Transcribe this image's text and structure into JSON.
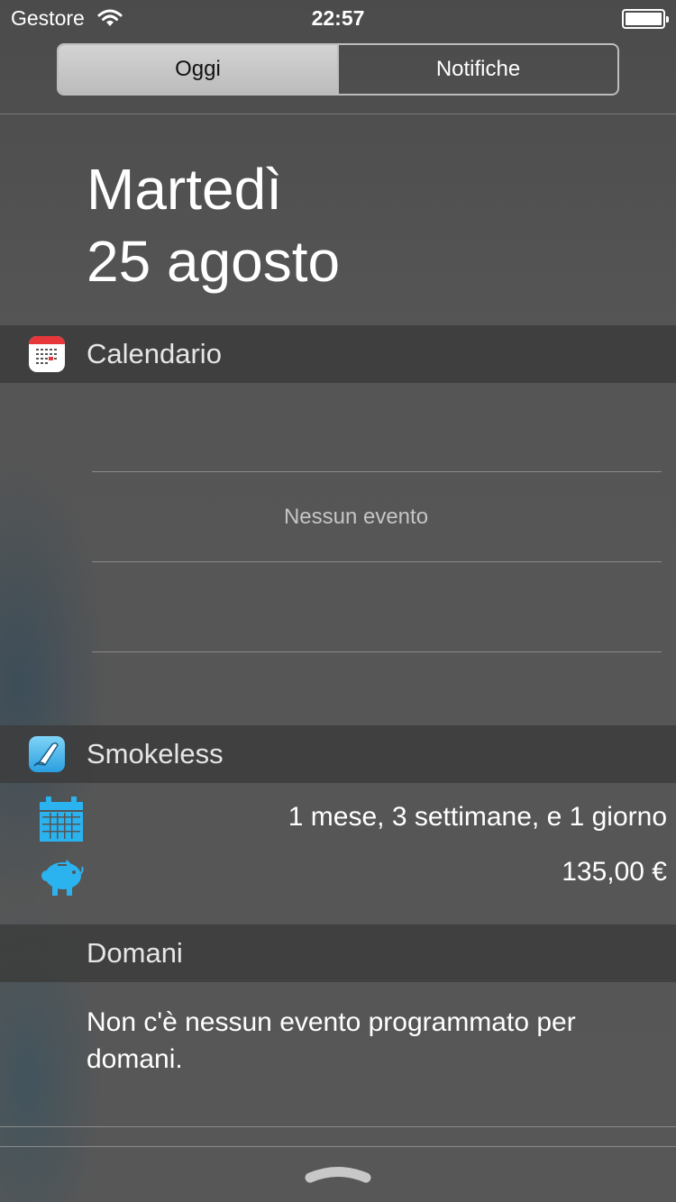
{
  "status_bar": {
    "carrier": "Gestore",
    "time": "22:57",
    "wifi_icon": "wifi-icon",
    "battery_icon": "battery-icon",
    "battery_level": 1.0
  },
  "tabs": [
    {
      "label": "Oggi",
      "active": true
    },
    {
      "label": "Notifiche",
      "active": false
    }
  ],
  "date": {
    "weekday": "Martedì",
    "day_month": "25 agosto"
  },
  "calendar_widget": {
    "title": "Calendario",
    "icon": "calendar-app-icon",
    "empty_text": "Nessun evento"
  },
  "smokeless_widget": {
    "title": "Smokeless",
    "icon": "smokeless-app-icon",
    "duration_icon": "calendar-grid-icon",
    "duration": "1 mese, 3 settimane, e 1 giorno",
    "savings_icon": "piggy-bank-icon",
    "savings": "135,00 €"
  },
  "tomorrow": {
    "title": "Domani",
    "text": "Non c'è nessun evento programmato per domani."
  },
  "colors": {
    "accent_blue": "#2bb3f0",
    "calendar_red": "#e8373a",
    "background": "#545454"
  },
  "grabber_icon": "chevron-up-grabber-icon"
}
